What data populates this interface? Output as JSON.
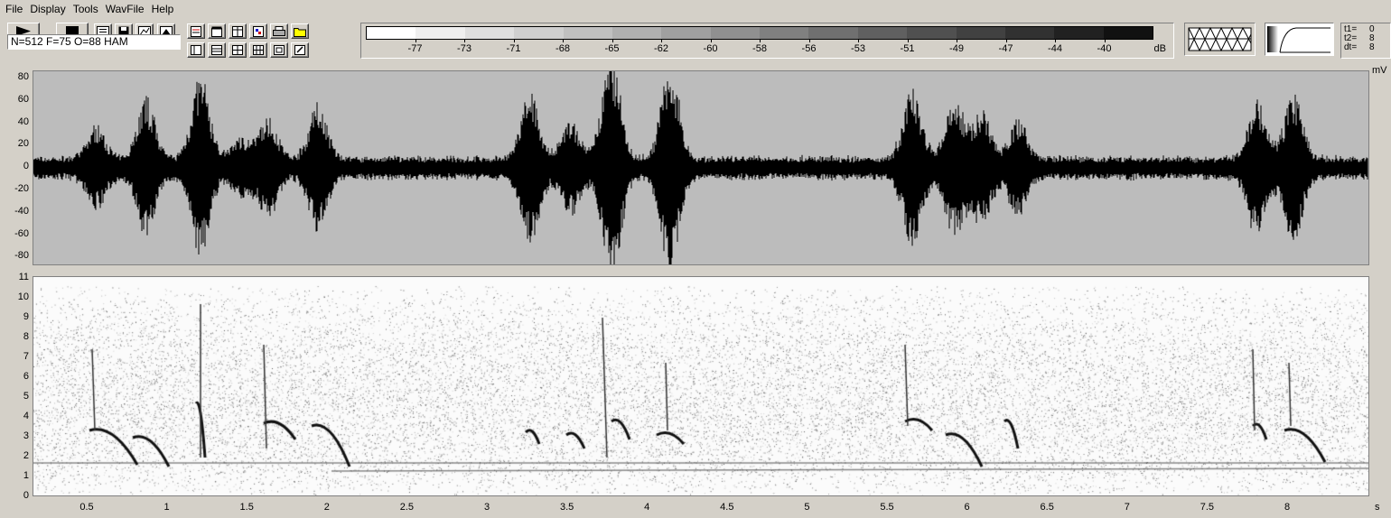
{
  "menu": [
    "File",
    "Display",
    "Tools",
    "WavFile",
    "Help"
  ],
  "toolbar": {
    "play_icon": "play-icon",
    "stop_icon": "stop-icon",
    "status_text": "N=512 F=75 O=88 HAM"
  },
  "db_scale": {
    "labels": [
      "-77",
      "-73",
      "-71",
      "-68",
      "-65",
      "-62",
      "-60",
      "-58",
      "-56",
      "-53",
      "-51",
      "-49",
      "-47",
      "-44",
      "-40"
    ],
    "unit": "dB"
  },
  "time_readout": {
    "rows": [
      {
        "label": "t1=",
        "value": "0"
      },
      {
        "label": "t2=",
        "value": "8"
      },
      {
        "label": "dt=",
        "value": "8"
      }
    ]
  },
  "waveform": {
    "unit": "mV",
    "y_ticks": [
      "80",
      "60",
      "40",
      "20",
      "0",
      "-20",
      "-40",
      "-60",
      "-80"
    ]
  },
  "spectrogram": {
    "y_ticks": [
      "11",
      "10",
      "9",
      "8",
      "7",
      "6",
      "5",
      "4",
      "3",
      "2",
      "1",
      "0"
    ],
    "x_ticks": [
      "0.5",
      "1",
      "1.5",
      "2",
      "2.5",
      "3",
      "3.5",
      "4",
      "4.5",
      "5",
      "5.5",
      "6",
      "6.5",
      "7",
      "7.5",
      "8"
    ],
    "x_unit": "s"
  },
  "colors": {
    "background": "#d4d0c8",
    "waveform_bg": "#bcbcbc",
    "trace": "#000000"
  }
}
